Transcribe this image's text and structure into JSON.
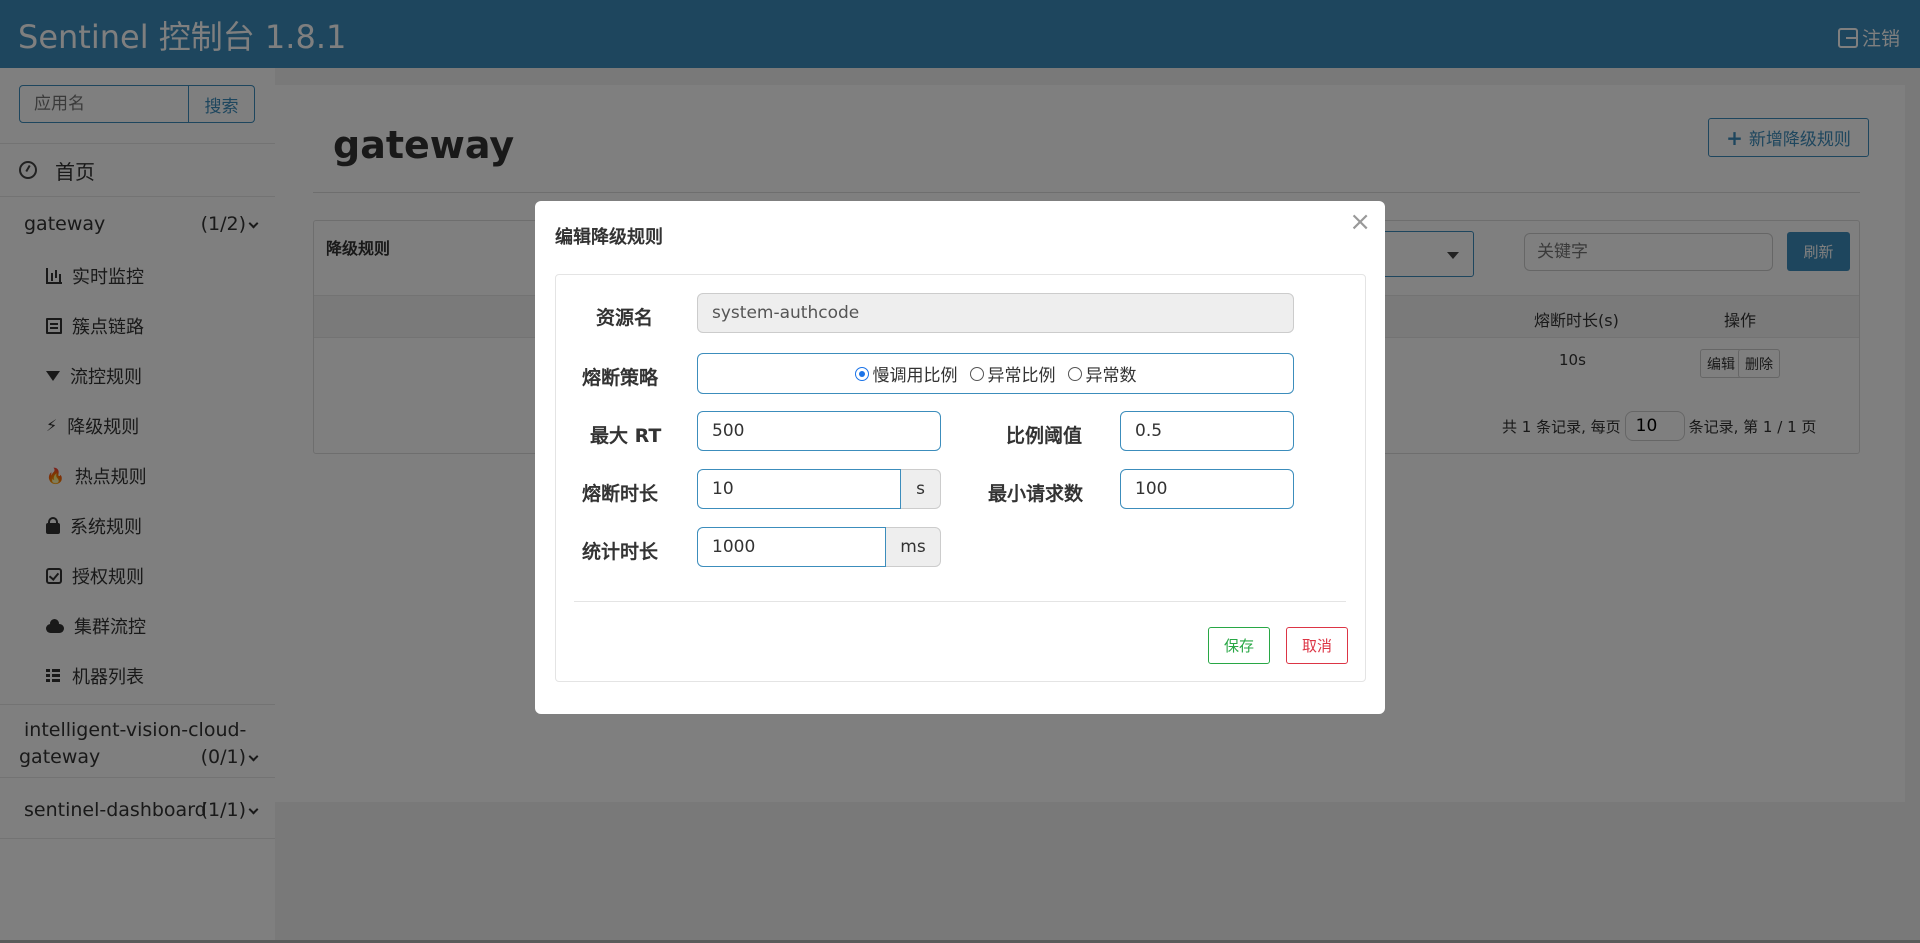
{
  "navbar": {
    "brand": "Sentinel 控制台 1.8.1",
    "logout_label": "注销"
  },
  "sidebar": {
    "search_placeholder": "应用名",
    "search_button": "搜索",
    "home_label": "首页",
    "apps": [
      {
        "name": "gateway",
        "count": "(1/2)"
      },
      {
        "name_line1": "intelligent-vision-cloud-",
        "name_line2": "gateway",
        "count": "(0/1)"
      },
      {
        "name": "sentinel-dashboard",
        "count": "(1/1)"
      }
    ],
    "menu": [
      {
        "label": "实时监控",
        "icon": "bar-chart-icon"
      },
      {
        "label": "簇点链路",
        "icon": "list-icon"
      },
      {
        "label": "流控规则",
        "icon": "filter-icon"
      },
      {
        "label": "降级规则",
        "icon": "bolt-icon"
      },
      {
        "label": "热点规则",
        "icon": "fire-icon"
      },
      {
        "label": "系统规则",
        "icon": "lock-icon"
      },
      {
        "label": "授权规则",
        "icon": "check-square-icon"
      },
      {
        "label": "集群流控",
        "icon": "cloud-icon"
      },
      {
        "label": "机器列表",
        "icon": "th-list-icon"
      }
    ]
  },
  "main": {
    "title": "gateway",
    "add_button": "新增降级规则",
    "panel": {
      "title": "降级规则",
      "keyword_placeholder": "关键字",
      "refresh_button": "刷新",
      "columns": {
        "duration": "熔断时长(s)",
        "ops": "操作"
      },
      "rows": [
        {
          "duration": "10s",
          "edit": "编辑",
          "delete": "删除"
        }
      ],
      "pager": {
        "prefix": "共 1 条记录, 每页",
        "page_size": "10",
        "suffix": "条记录, 第 1 / 1 页"
      }
    }
  },
  "modal": {
    "title": "编辑降级规则",
    "close": "×",
    "fields": {
      "resource": {
        "label": "资源名",
        "value": "system-authcode"
      },
      "strategy": {
        "label": "熔断策略",
        "options": [
          "慢调用比例",
          "异常比例",
          "异常数"
        ],
        "selected": "慢调用比例"
      },
      "max_rt": {
        "label": "最大 RT",
        "value": "500"
      },
      "ratio": {
        "label": "比例阈值",
        "value": "0.5"
      },
      "duration": {
        "label": "熔断时长",
        "value": "10",
        "unit": "s"
      },
      "min_req": {
        "label": "最小请求数",
        "value": "100"
      },
      "stat": {
        "label": "统计时长",
        "value": "1000",
        "unit": "ms"
      }
    },
    "save_button": "保存",
    "cancel_button": "取消"
  },
  "colors": {
    "primary": "#3c8dbc",
    "success": "#28a745",
    "danger": "#dc3545"
  }
}
